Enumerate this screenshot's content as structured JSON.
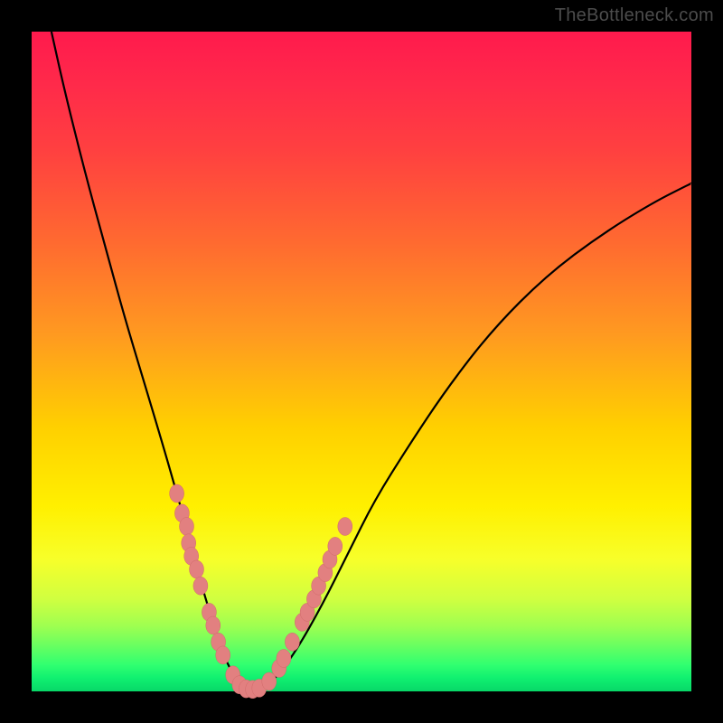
{
  "watermark": "TheBottleneck.com",
  "colors": {
    "frame": "#000000",
    "curve": "#000000",
    "dot_fill": "#e28080",
    "dot_stroke": "#d06a6a",
    "gradient_top": "#ff1a4d",
    "gradient_bottom": "#08d868"
  },
  "chart_data": {
    "type": "line",
    "title": "",
    "xlabel": "",
    "ylabel": "",
    "xlim": [
      0,
      100
    ],
    "ylim": [
      0,
      100
    ],
    "grid": false,
    "legend": false,
    "series": [
      {
        "name": "bottleneck-curve",
        "x": [
          3,
          5,
          8,
          11,
          14,
          17,
          20,
          22,
          24,
          25.5,
          27,
          28.5,
          30,
          31.5,
          33,
          35,
          37,
          40,
          44,
          48,
          52,
          57,
          63,
          70,
          78,
          86,
          94,
          100
        ],
        "y": [
          100,
          91,
          79,
          68,
          57,
          47,
          37,
          30,
          23,
          17,
          12,
          7,
          3.5,
          1.2,
          0.3,
          0.4,
          2,
          6,
          13,
          21,
          29,
          37,
          46,
          55,
          63,
          69,
          74,
          77
        ]
      }
    ],
    "scatter": {
      "name": "overlay-dots",
      "points": [
        {
          "x": 22.0,
          "y": 30.0
        },
        {
          "x": 22.8,
          "y": 27.0
        },
        {
          "x": 23.5,
          "y": 25.0
        },
        {
          "x": 23.8,
          "y": 22.5
        },
        {
          "x": 24.2,
          "y": 20.5
        },
        {
          "x": 25.0,
          "y": 18.5
        },
        {
          "x": 25.6,
          "y": 16.0
        },
        {
          "x": 26.9,
          "y": 12.0
        },
        {
          "x": 27.5,
          "y": 10.0
        },
        {
          "x": 28.3,
          "y": 7.5
        },
        {
          "x": 29.0,
          "y": 5.5
        },
        {
          "x": 30.5,
          "y": 2.5
        },
        {
          "x": 31.5,
          "y": 1.0
        },
        {
          "x": 32.5,
          "y": 0.4
        },
        {
          "x": 33.5,
          "y": 0.3
        },
        {
          "x": 34.5,
          "y": 0.5
        },
        {
          "x": 36.0,
          "y": 1.5
        },
        {
          "x": 37.5,
          "y": 3.5
        },
        {
          "x": 38.2,
          "y": 5.0
        },
        {
          "x": 39.5,
          "y": 7.5
        },
        {
          "x": 41.0,
          "y": 10.5
        },
        {
          "x": 41.8,
          "y": 12.0
        },
        {
          "x": 42.8,
          "y": 14.0
        },
        {
          "x": 43.5,
          "y": 16.0
        },
        {
          "x": 44.5,
          "y": 18.0
        },
        {
          "x": 45.2,
          "y": 20.0
        },
        {
          "x": 46.0,
          "y": 22.0
        },
        {
          "x": 47.5,
          "y": 25.0
        }
      ]
    },
    "note": "x and y in 0–100 units; y=0 at bottom (green), y=100 at top (red). Curve values read off the plot; dots are the salmon-colored points clustered along the V near the trough."
  }
}
